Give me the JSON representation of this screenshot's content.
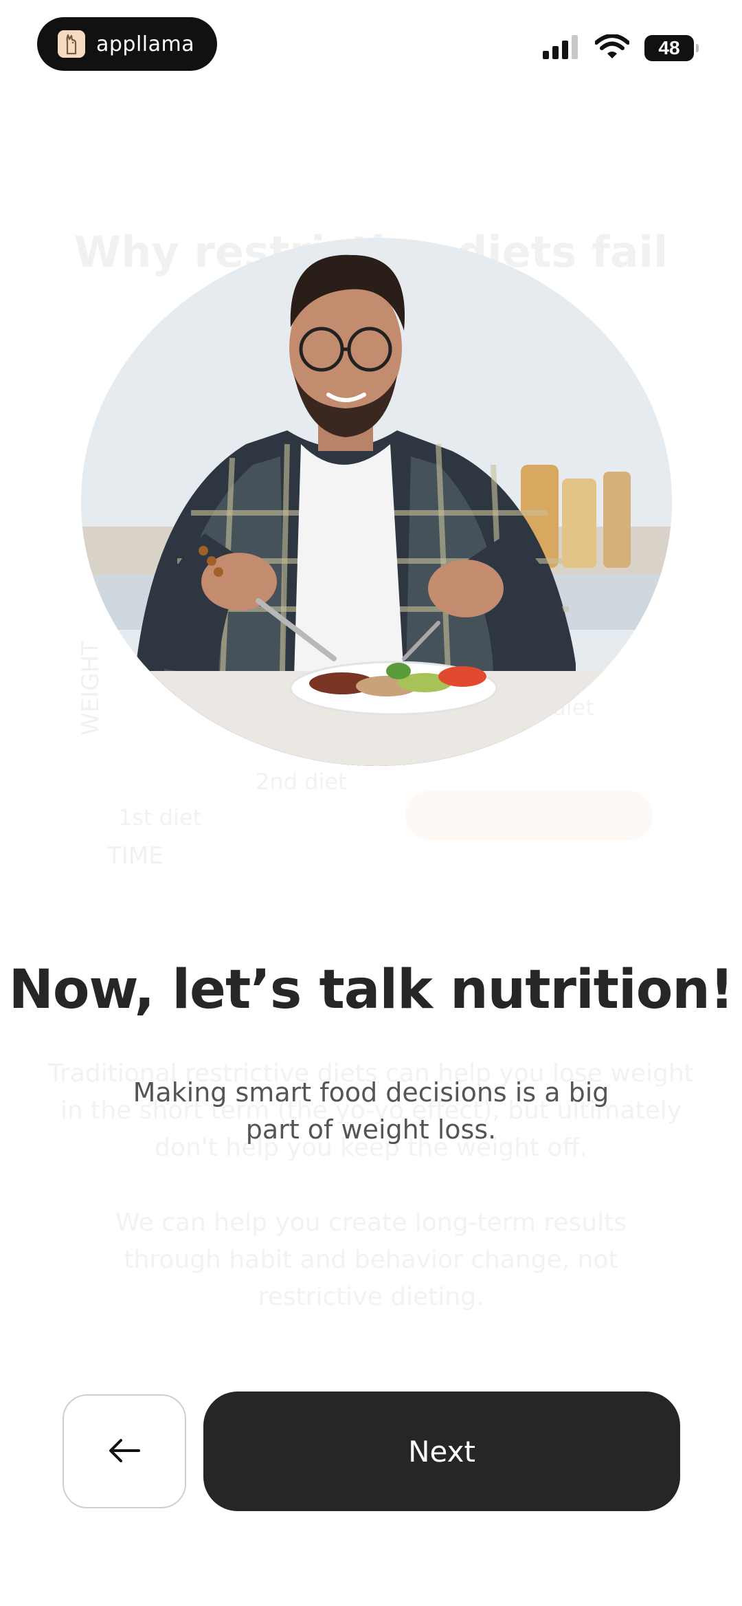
{
  "status_bar": {
    "brand": "appllama",
    "battery": "48",
    "icons": [
      "llama-logo-icon",
      "cellular-signal-icon",
      "wifi-icon",
      "battery-icon"
    ]
  },
  "background_screen": {
    "title": "Why restrictive diets fail",
    "y_axis": "WEIGHT",
    "x_axis": "TIME",
    "label_first": "1st diet",
    "label_second": "2nd diet",
    "label_third": "3rd diet",
    "paragraph_1": "Traditional restrictive diets can help you lose weight in the short term (the yo-yo effect), but ultimately don't help you keep the weight off.",
    "paragraph_2": "We can help you create long-term results through habit and behavior change, not restrictive dieting."
  },
  "main": {
    "headline": "Now, let’s talk nutrition!",
    "subtitle": "Making smart food decisions is a big part of weight loss."
  },
  "nav": {
    "back_icon": "arrow-left-icon",
    "next_label": "Next"
  }
}
